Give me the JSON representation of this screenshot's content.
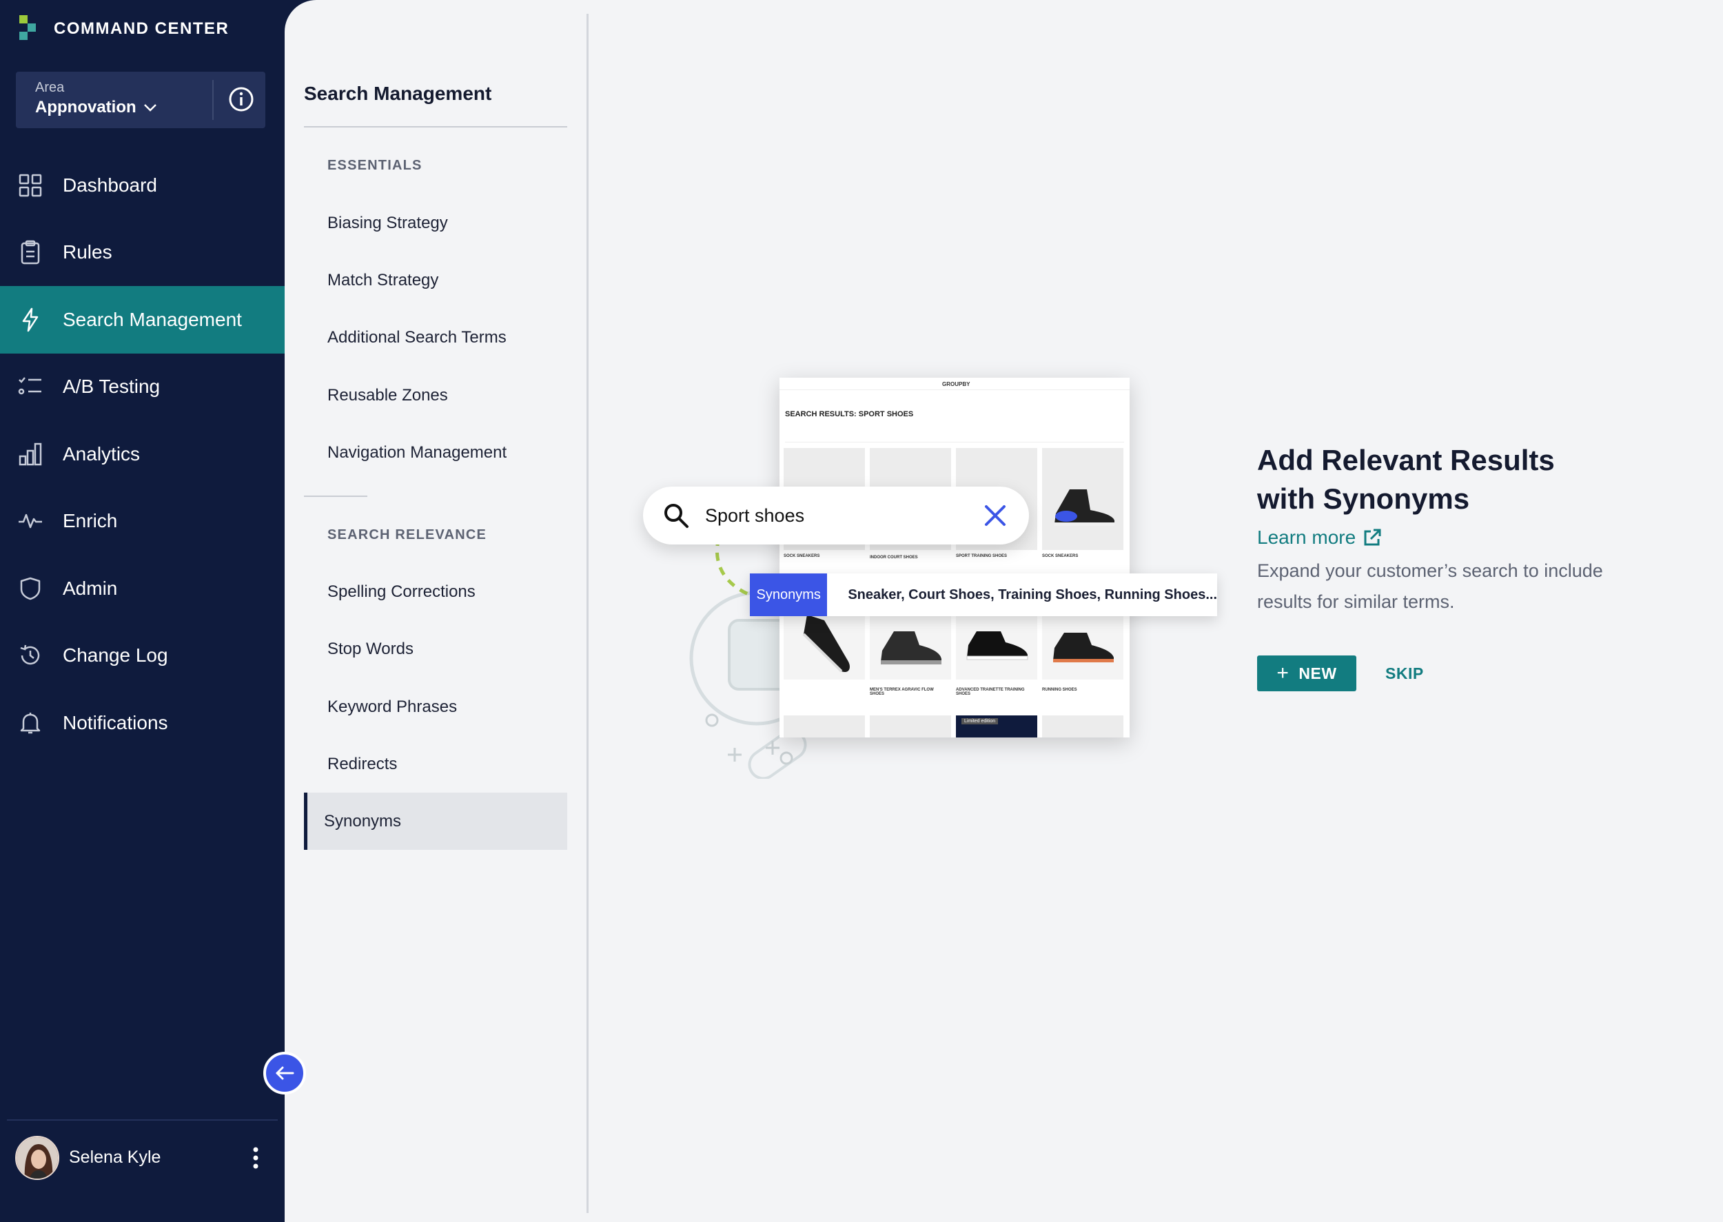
{
  "brand": {
    "name": "COMMAND CENTER"
  },
  "area": {
    "label": "Area",
    "value": "Appnovation"
  },
  "nav": {
    "items": [
      {
        "label": "Dashboard",
        "icon": "dashboard-grid-icon"
      },
      {
        "label": "Rules",
        "icon": "clipboard-icon"
      },
      {
        "label": "Search Management",
        "icon": "lightning-icon",
        "active": true
      },
      {
        "label": "A/B Testing",
        "icon": "checklist-icon"
      },
      {
        "label": "Analytics",
        "icon": "bar-chart-icon"
      },
      {
        "label": "Enrich",
        "icon": "pulse-icon"
      },
      {
        "label": "Admin",
        "icon": "shield-icon"
      },
      {
        "label": "Change Log",
        "icon": "history-icon"
      },
      {
        "label": "Notifications",
        "icon": "bell-icon"
      }
    ]
  },
  "user": {
    "name": "Selena Kyle"
  },
  "subnav": {
    "title": "Search Management",
    "sections": [
      {
        "title": "ESSENTIALS",
        "items": [
          "Biasing Strategy",
          "Match Strategy",
          "Additional Search Terms",
          "Reusable Zones",
          "Navigation Management"
        ]
      },
      {
        "title": "SEARCH RELEVANCE",
        "items": [
          "Spelling Corrections",
          "Stop Words",
          "Keyword Phrases",
          "Redirects",
          "Synonyms"
        ]
      }
    ],
    "selected": "Synonyms"
  },
  "illustration": {
    "search_text": "Sport shoes",
    "synonym_chip": "Synonyms",
    "synonym_terms": "Sneaker, Court Shoes, Training Shoes, Running Shoes...",
    "mock_brand": "GROUPBY",
    "mock_heading": "SEARCH RESULTS: SPORT SHOES",
    "mock_captions": [
      "SOCK SNEAKERS",
      "INDOOR COURT SHOES",
      "SPORT TRAINING SHOES",
      "SOCK SNEAKERS",
      "MEN'S TERREX AGRAVIC FLOW SHOES",
      "ADVANCED TRAINETTE TRAINING SHOES",
      "RUNNING SHOES"
    ],
    "mock_badge": "Limited edition"
  },
  "empty_state": {
    "title_line1": "Add Relevant Results",
    "title_line2": "with Synonyms",
    "learn_more": "Learn more",
    "description": "Expand your customer’s search to include results for similar terms.",
    "new_button": "NEW",
    "skip_button": "SKIP"
  },
  "colors": {
    "nav_bg": "#0f1b3d",
    "accent_teal": "#127c80",
    "accent_blue": "#3b55e6",
    "content_bg": "#f3f4f6"
  }
}
